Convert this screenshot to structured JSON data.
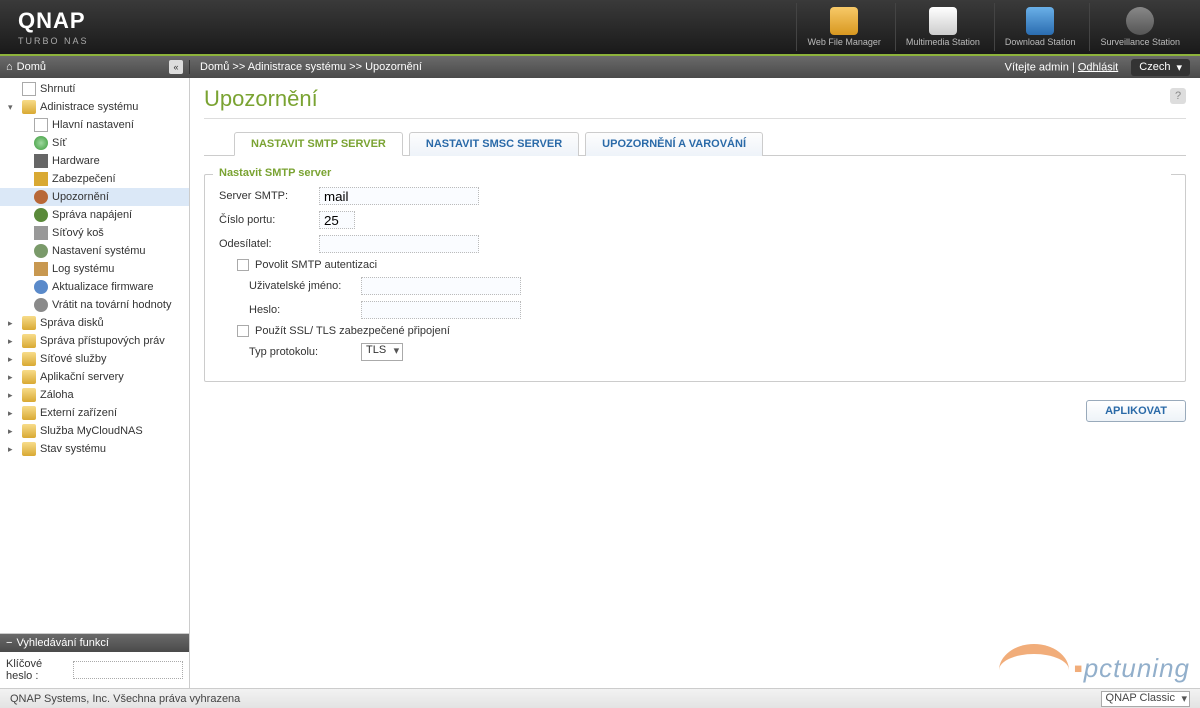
{
  "brand": {
    "name": "QNAP",
    "tagline": "TURBO NAS"
  },
  "header_apps": [
    {
      "label": "Web File Manager",
      "icon": "folder"
    },
    {
      "label": "Multimedia Station",
      "icon": "media"
    },
    {
      "label": "Download Station",
      "icon": "download"
    },
    {
      "label": "Surveillance Station",
      "icon": "surveil"
    }
  ],
  "topbar": {
    "home_label": "Domů",
    "breadcrumb": "Domů >> Adinistrace systému >> Upozornění",
    "welcome": "Vítejte admin",
    "logout": "Odhlásit",
    "language": "Czech"
  },
  "tree": {
    "items": [
      {
        "label": "Shrnutí",
        "level": 0,
        "icon": "page",
        "toggle": ""
      },
      {
        "label": "Adinistrace systému",
        "level": 0,
        "icon": "folder",
        "toggle": "▾",
        "expanded": true
      },
      {
        "label": "Hlavní nastavení",
        "level": 1,
        "icon": "page"
      },
      {
        "label": "Síť",
        "level": 1,
        "icon": "net"
      },
      {
        "label": "Hardware",
        "level": 1,
        "icon": "hw"
      },
      {
        "label": "Zabezpečení",
        "level": 1,
        "icon": "lock"
      },
      {
        "label": "Upozornění",
        "level": 1,
        "icon": "bell",
        "selected": true
      },
      {
        "label": "Správa napájení",
        "level": 1,
        "icon": "power"
      },
      {
        "label": "Síťový koš",
        "level": 1,
        "icon": "trash"
      },
      {
        "label": "Nastavení systému",
        "level": 1,
        "icon": "gear"
      },
      {
        "label": "Log systému",
        "level": 1,
        "icon": "log"
      },
      {
        "label": "Aktualizace firmware",
        "level": 1,
        "icon": "update"
      },
      {
        "label": "Vrátit na tovární hodnoty",
        "level": 1,
        "icon": "reset"
      },
      {
        "label": "Správa disků",
        "level": 0,
        "icon": "folder",
        "toggle": "▸"
      },
      {
        "label": "Správa přístupových práv",
        "level": 0,
        "icon": "folder",
        "toggle": "▸"
      },
      {
        "label": "Síťové služby",
        "level": 0,
        "icon": "folder",
        "toggle": "▸"
      },
      {
        "label": "Aplikační servery",
        "level": 0,
        "icon": "folder",
        "toggle": "▸"
      },
      {
        "label": "Záloha",
        "level": 0,
        "icon": "folder",
        "toggle": "▸"
      },
      {
        "label": "Externí zařízení",
        "level": 0,
        "icon": "folder",
        "toggle": "▸"
      },
      {
        "label": "Služba MyCloudNAS",
        "level": 0,
        "icon": "folder",
        "toggle": "▸"
      },
      {
        "label": "Stav systému",
        "level": 0,
        "icon": "folder",
        "toggle": "▸"
      }
    ]
  },
  "search": {
    "title": "Vyhledávání funkcí",
    "label": "Klíčové heslo :",
    "value": ""
  },
  "page": {
    "title": "Upozornění",
    "tabs": [
      {
        "label": "NASTAVIT SMTP SERVER",
        "active": true
      },
      {
        "label": "NASTAVIT SMSC SERVER",
        "active": false
      },
      {
        "label": "UPOZORNĚNÍ A VAROVÁNÍ",
        "active": false
      }
    ],
    "fieldset_legend": "Nastavit SMTP server",
    "form": {
      "smtp_label": "Server SMTP:",
      "smtp_value": "mail",
      "port_label": "Číslo portu:",
      "port_value": "25",
      "sender_label": "Odesílatel:",
      "sender_value": "",
      "auth_label": "Povolit SMTP autentizaci",
      "user_label": "Uživatelské jméno:",
      "user_value": "",
      "pass_label": "Heslo:",
      "pass_value": "",
      "ssl_label": "Použít SSL/ TLS zabezpečené připojení",
      "proto_label": "Typ protokolu:",
      "proto_value": "TLS"
    },
    "apply_button": "APLIKOVAT"
  },
  "footer": {
    "copyright": "QNAP Systems, Inc. Všechna práva vyhrazena",
    "theme": "QNAP Classic"
  },
  "watermark": "pctuning"
}
